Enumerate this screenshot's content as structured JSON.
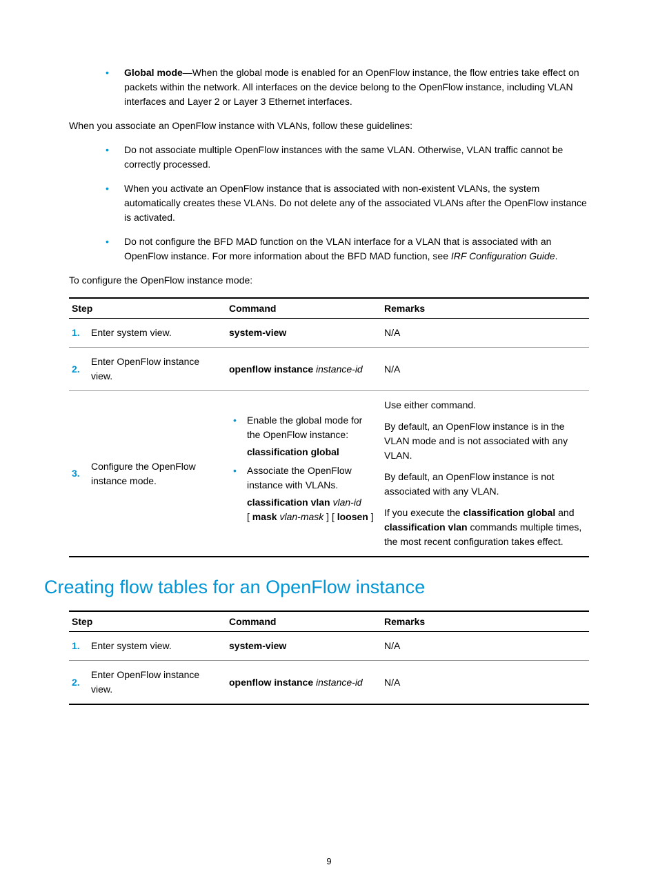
{
  "bullet1": {
    "label": "Global mode",
    "text": "—When the global mode is enabled for an OpenFlow instance, the flow entries take effect on packets within the network. All interfaces on the device belong to the OpenFlow instance, including VLAN interfaces and Layer 2 or Layer 3 Ethernet interfaces."
  },
  "guidelines_intro": "When you associate an OpenFlow instance with VLANs, follow these guidelines:",
  "guidelines": [
    "Do not associate multiple OpenFlow instances with the same VLAN. Otherwise, VLAN traffic cannot be correctly processed.",
    "When you activate an OpenFlow instance that is associated with non-existent VLANs, the system automatically creates these VLANs. Do not delete any of the associated VLANs after the OpenFlow instance is activated."
  ],
  "guideline3": {
    "prefix": "Do not configure the BFD MAD function on the VLAN interface for a VLAN that is associated with an OpenFlow instance. For more information about the BFD MAD function, see ",
    "italic": "IRF Configuration Guide",
    "suffix": "."
  },
  "config_intro": "To configure the OpenFlow instance mode:",
  "table_headers": {
    "step": "Step",
    "command": "Command",
    "remarks": "Remarks"
  },
  "table1": {
    "r1": {
      "num": "1.",
      "step": "Enter system view.",
      "cmd": "system-view",
      "remarks": "N/A"
    },
    "r2": {
      "num": "2.",
      "step": "Enter OpenFlow instance view.",
      "cmd_bold": "openflow instance",
      "cmd_italic": "instance-id",
      "remarks": "N/A"
    },
    "r3": {
      "num": "3.",
      "step": "Configure the OpenFlow instance mode.",
      "cmd_b1_text": "Enable the global mode for the OpenFlow instance:",
      "cmd_b1_bold": "classification global",
      "cmd_b2_text": "Associate the OpenFlow instance with VLANs.",
      "cmd_b2_bold1": "classification vlan",
      "cmd_b2_italic1": "vlan-id",
      "cmd_b2_bracket1": "[ ",
      "cmd_b2_bold2": "mask",
      "cmd_b2_italic2": "vlan-mask",
      "cmd_b2_bracket2": " ] [ ",
      "cmd_b2_bold3": "loosen",
      "cmd_b2_bracket3": " ]",
      "rem_p1": "Use either command.",
      "rem_p2": "By default, an OpenFlow instance is in the VLAN mode and is not associated with any VLAN.",
      "rem_p3": "By default, an OpenFlow instance is not associated with any VLAN.",
      "rem_p4_pre": "If you execute the ",
      "rem_p4_b1": "classification global",
      "rem_p4_mid": " and ",
      "rem_p4_b2": "classification vlan",
      "rem_p4_post": " commands multiple times, the most recent configuration takes effect."
    }
  },
  "heading": "Creating flow tables for an OpenFlow instance",
  "table2": {
    "r1": {
      "num": "1.",
      "step": "Enter system view.",
      "cmd": "system-view",
      "remarks": "N/A"
    },
    "r2": {
      "num": "2.",
      "step": "Enter OpenFlow instance view.",
      "cmd_bold": "openflow instance",
      "cmd_italic": "instance-id",
      "remarks": "N/A"
    }
  },
  "page_number": "9"
}
